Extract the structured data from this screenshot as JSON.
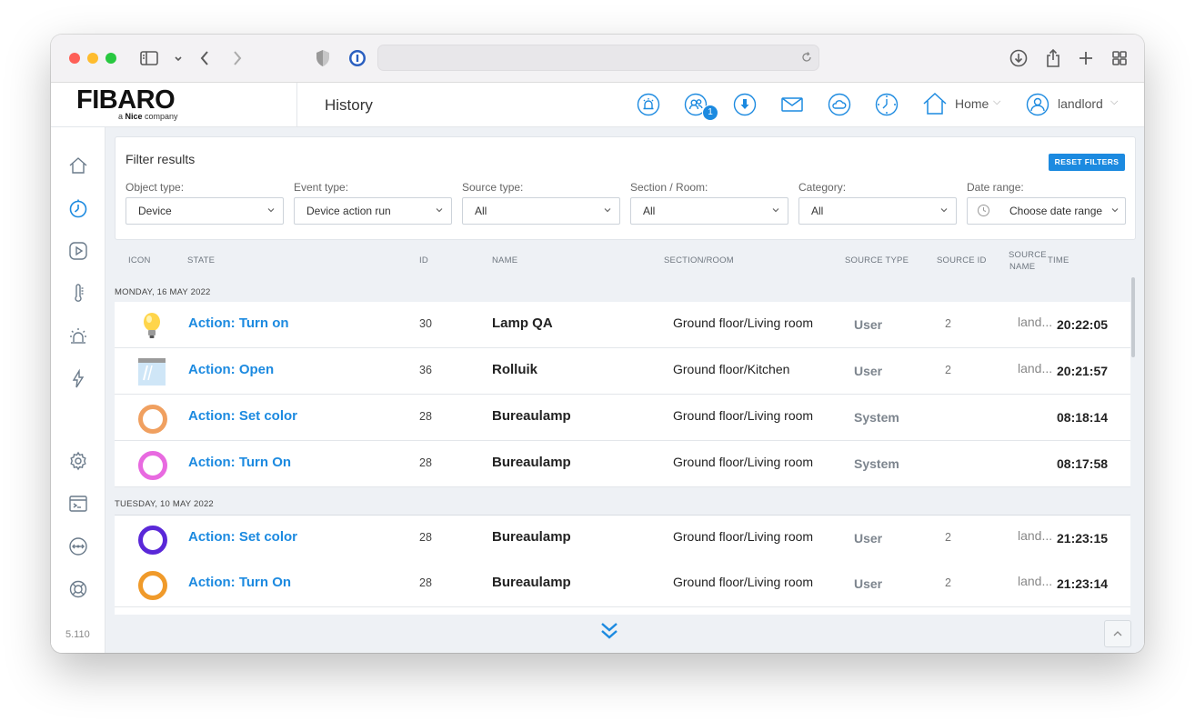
{
  "app": {
    "logo": "FIBARO",
    "logo_sub_prefix": "a ",
    "logo_sub_brand": "Nice",
    "logo_sub_suffix": " company",
    "page_title": "History",
    "version": "5.110"
  },
  "header": {
    "users_badge": "1",
    "home_label": "Home",
    "user_label": "landlord"
  },
  "filters": {
    "title": "Filter results",
    "reset_label": "RESET FILTERS",
    "fields": [
      {
        "label": "Object type:",
        "value": "Device"
      },
      {
        "label": "Event type:",
        "value": "Device action run"
      },
      {
        "label": "Source type:",
        "value": "All"
      },
      {
        "label": "Section / Room:",
        "value": "All"
      },
      {
        "label": "Category:",
        "value": "All"
      },
      {
        "label": "Date range:",
        "value": "Choose date range"
      }
    ]
  },
  "table": {
    "columns": {
      "icon": "ICON",
      "state": "STATE",
      "id": "ID",
      "name": "NAME",
      "section_room": "SECTION/ROOM",
      "source_type": "SOURCE TYPE",
      "source_id": "SOURCE ID",
      "source_name_1": "SOURCE",
      "source_name_2": "NAME",
      "time": "TIME"
    },
    "days": [
      {
        "label": "MONDAY, 16 MAY 2022",
        "rows": [
          {
            "icon": "bulb-icon",
            "state": "Action: Turn on",
            "id": "30",
            "name": "Lamp QA",
            "room": "Ground floor/Living room",
            "source_type": "User",
            "source_id": "2",
            "source_name": "land...",
            "time": "20:22:05"
          },
          {
            "icon": "blind-icon",
            "state": "Action: Open",
            "id": "36",
            "name": "Rolluik",
            "room": "Ground floor/Kitchen",
            "source_type": "User",
            "source_id": "2",
            "source_name": "land...",
            "time": "20:21:57"
          },
          {
            "icon": "color-ring-icon",
            "color": "#f0a060",
            "state": "Action: Set color",
            "id": "28",
            "name": "Bureaulamp",
            "room": "Ground floor/Living room",
            "source_type": "System",
            "source_id": "",
            "source_name": "",
            "time": "08:18:14"
          },
          {
            "icon": "color-ring-icon",
            "color": "#e86ae0",
            "state": "Action: Turn On",
            "id": "28",
            "name": "Bureaulamp",
            "room": "Ground floor/Living room",
            "source_type": "System",
            "source_id": "",
            "source_name": "",
            "time": "08:17:58"
          }
        ]
      },
      {
        "label": "TUESDAY, 10 MAY 2022",
        "rows": [
          {
            "icon": "color-ring-icon",
            "color": "#5a28d8",
            "state": "Action: Set color",
            "id": "28",
            "name": "Bureaulamp",
            "room": "Ground floor/Living room",
            "source_type": "User",
            "source_id": "2",
            "source_name": "land...",
            "time": "21:23:15"
          },
          {
            "icon": "color-ring-icon",
            "color": "#f09a2a",
            "state": "Action: Turn On",
            "id": "28",
            "name": "Bureaulamp",
            "room": "Ground floor/Living room",
            "source_type": "User",
            "source_id": "2",
            "source_name": "land...",
            "time": "21:23:14"
          }
        ]
      }
    ]
  },
  "colors": {
    "accent": "#1c8ae0",
    "background": "#eef1f5"
  }
}
